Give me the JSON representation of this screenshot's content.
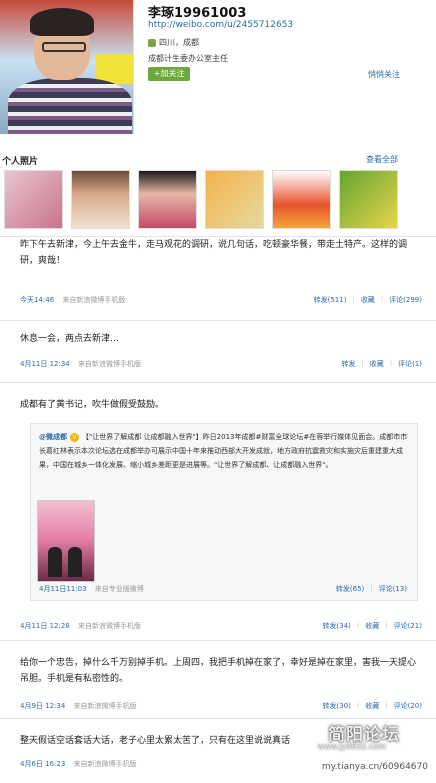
{
  "profile": {
    "name": "李琢19961003",
    "url": "http://weibo.com/u/2455712653",
    "location": "四川，成都",
    "description": "成都计生委办公室主任",
    "follow_label": "+加关注",
    "silent_follow_label": "悄悄关注"
  },
  "photos": {
    "title": "个人照片",
    "view_all": "查看全部"
  },
  "posts": [
    {
      "text": "昨下午去新津，今上午去金牛，走马观花的调研，说几句话，吃顿豪华餐，带走土特产。这样的调研，爽哉！",
      "time": "今天14:46",
      "source": "来自新浪微博手机版",
      "repost": "转发(511)",
      "favorite": "收藏",
      "comment": "评论(299)"
    },
    {
      "text": "休息一会，两点去新津…",
      "time": "4月11日 12:34",
      "source": "来自新浪微博手机版",
      "repost": "转发",
      "favorite": "收藏",
      "comment": "评论(1)"
    },
    {
      "text": "成都有了黄书记，吹牛做假受鼓励。",
      "time": "4月11日 12:28",
      "source": "来自新浪微博手机版",
      "repost": "转发(34)",
      "favorite": "收藏",
      "comment": "评论(21)",
      "quoted": {
        "author": "@微成都",
        "text": "【\"让世界了解成都 让成都融入世界\"】昨日2013年成都#财富全球论坛#在蓉举行媒体见面会。成都市市长葛红林表示本次论坛选在成都举办可展示中国十年来推动西部大开发成就，地方政府抗震救灾和实施灾后重建重大成果，中国在城乡一体化发展、缩小城乡差距更是进展等。\"让世界了解成都、让成都融入世界\"。",
        "time": "4月11日11:03",
        "source": "来自专业版微博",
        "repost": "转发(65)",
        "comment": "评论(13)"
      }
    },
    {
      "text": "给你一个忠告，掉什么千万别掉手机。上周四，我把手机掉在家了，幸好是掉在家里，害我一天提心吊胆。手机是有私密性的。",
      "time": "4月9日 12:34",
      "source": "来自新浪微博手机版",
      "repost": "转发(30)",
      "favorite": "收藏",
      "comment": "评论(20)"
    },
    {
      "text": "整天假话空话套话大话，老子心里太累太苦了，只有在这里说说真话",
      "time": "4月6日 16:23",
      "source": "来自新浪微博手机版",
      "repost": "",
      "favorite": "",
      "comment": ""
    }
  ],
  "watermark": {
    "main": "简阳论坛",
    "site": "www.jy0832.com",
    "url": "my.tianya.cn/60964670"
  }
}
